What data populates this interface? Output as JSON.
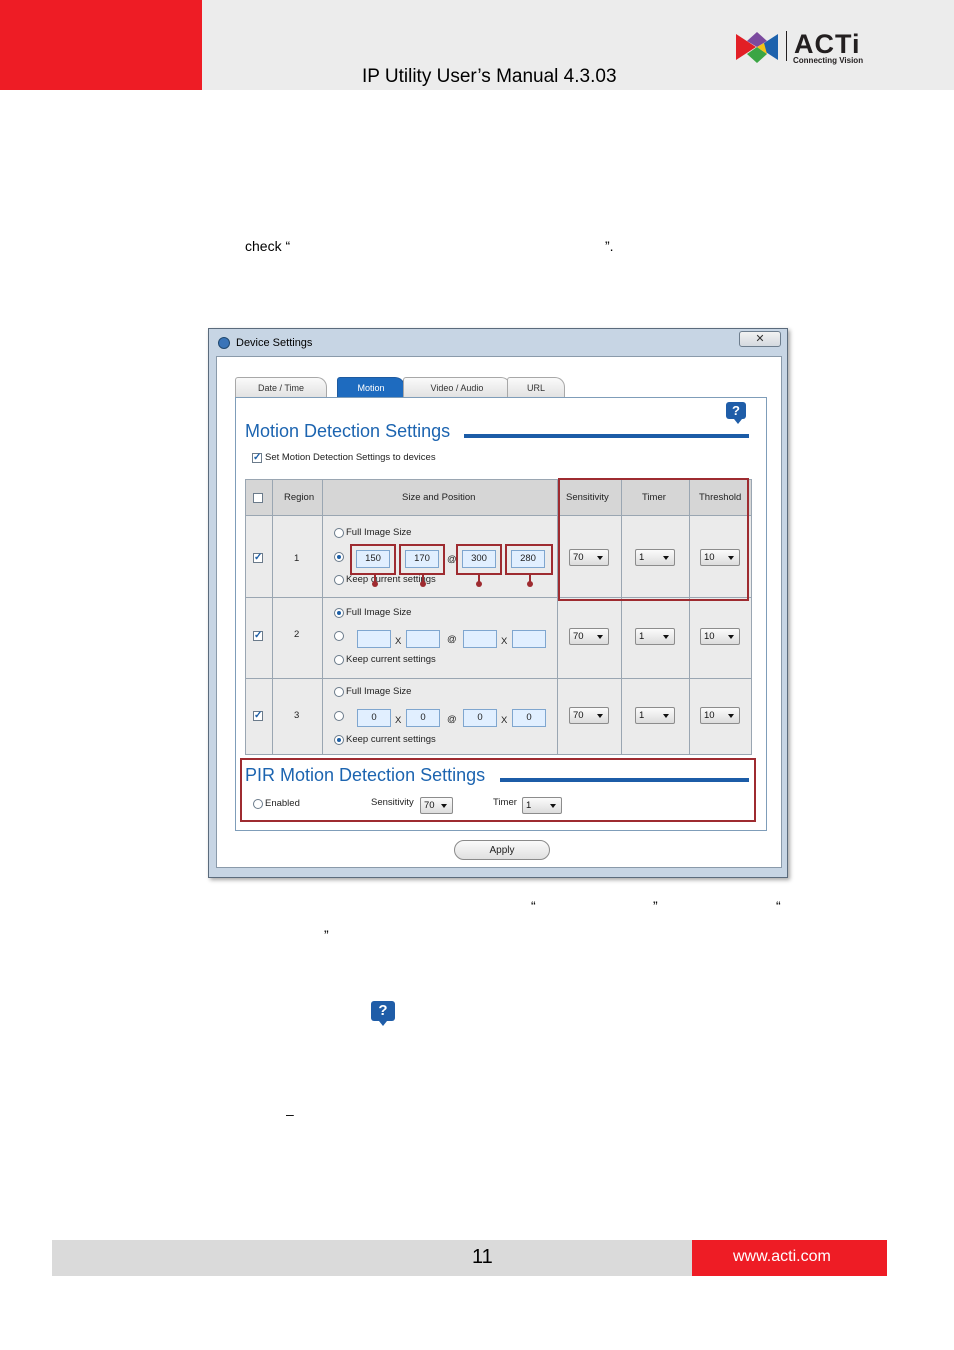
{
  "header": {
    "title": "IP Utility User’s Manual 4.3.03",
    "logo_word": "ACTi",
    "logo_tagline": "Connecting Vision"
  },
  "body": {
    "check_prefix": "check “",
    "check_suffix": "”.",
    "quote_open_1": "“",
    "quote_close_1": "”",
    "quote_open_2": "“",
    "quote_close_2": "”",
    "dash": "–"
  },
  "dialog": {
    "title": "Device Settings",
    "close_glyph": "✕",
    "tabs": [
      {
        "label": "Date / Time",
        "active": false
      },
      {
        "label": "Motion",
        "active": true
      },
      {
        "label": "Video / Audio",
        "active": false
      },
      {
        "label": "URL",
        "active": false
      }
    ],
    "help_glyph": "?",
    "motion": {
      "title": "Motion Detection Settings",
      "set_checkbox_label": "Set Motion Detection Settings to devices",
      "columns": [
        "Region",
        "Size and Position",
        "Sensitivity",
        "Timer",
        "Threshold"
      ],
      "full_image_label": "Full Image Size",
      "keep_label": "Keep current settings",
      "x_sep": "X",
      "at_sep": "@",
      "regions": [
        {
          "region": "1",
          "selected": "custom",
          "values": [
            "150",
            "170",
            "300",
            "280"
          ],
          "sensitivity": "70",
          "timer": "1",
          "threshold": "10"
        },
        {
          "region": "2",
          "selected": "full",
          "values": [
            "",
            "",
            "",
            ""
          ],
          "sensitivity": "70",
          "timer": "1",
          "threshold": "10"
        },
        {
          "region": "3",
          "selected": "keep",
          "values": [
            "0",
            "0",
            "0",
            "0"
          ],
          "sensitivity": "70",
          "timer": "1",
          "threshold": "10"
        }
      ]
    },
    "pir": {
      "title": "PIR Motion Detection Settings",
      "enabled_label": "Enabled",
      "sensitivity_label": "Sensitivity",
      "sensitivity_value": "70",
      "timer_label": "Timer",
      "timer_value": "1"
    },
    "apply_label": "Apply"
  },
  "footer": {
    "page_number": "11",
    "url": "www.acti.com"
  },
  "colors": {
    "brand_red": "#ee1c25",
    "accent_blue": "#1c64b0",
    "annotation_red": "#9e2b30"
  }
}
